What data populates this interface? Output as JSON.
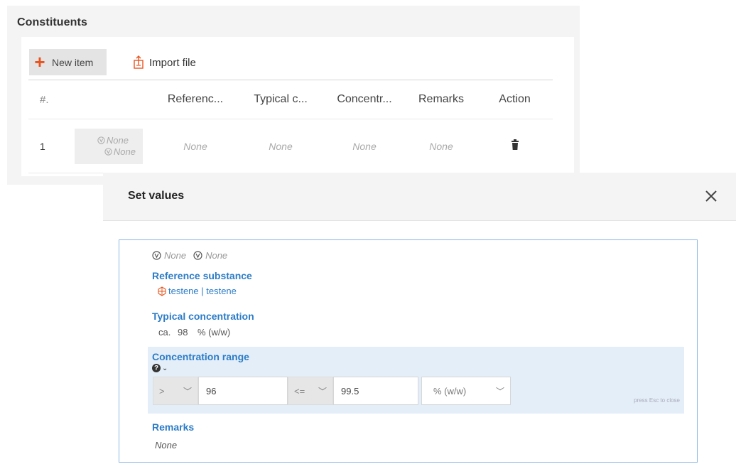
{
  "constituents": {
    "title": "Constituents",
    "new_item_label": "New item",
    "import_file_label": "Import file",
    "columns": [
      "#.",
      "Referenc...",
      "Typical c...",
      "Concentr...",
      "Remarks",
      "Action"
    ],
    "row": {
      "index": "1",
      "selector_line1": "None",
      "selector_line2": "None",
      "reference": "None",
      "typical": "None",
      "concentration": "None",
      "remarks": "None"
    }
  },
  "dialog": {
    "title": "Set values",
    "tags": [
      "None",
      "None"
    ],
    "reference_label": "Reference substance",
    "reference_value": "testene | testene",
    "typical_label": "Typical concentration",
    "typical_qualifier": "ca.",
    "typical_value": "98",
    "typical_unit": "% (w/w)",
    "range_label": "Concentration range",
    "lower_qualifier": ">",
    "lower_value": "96",
    "upper_qualifier": "<=",
    "upper_value": "99.5",
    "range_unit": "% (w/w)",
    "esc_hint": "press Esc to close",
    "remarks_label": "Remarks",
    "remarks_value": "None"
  },
  "colors": {
    "accent_blue": "#2c7cc7",
    "orange": "#e8541e",
    "panel_border": "#8bb6e6",
    "range_bg": "#e4eef8"
  },
  "icons": [
    "plus-icon",
    "import-file-icon",
    "trash-icon",
    "close-icon",
    "tag-icon",
    "structure-icon",
    "help-icon",
    "chevron-down-icon"
  ]
}
